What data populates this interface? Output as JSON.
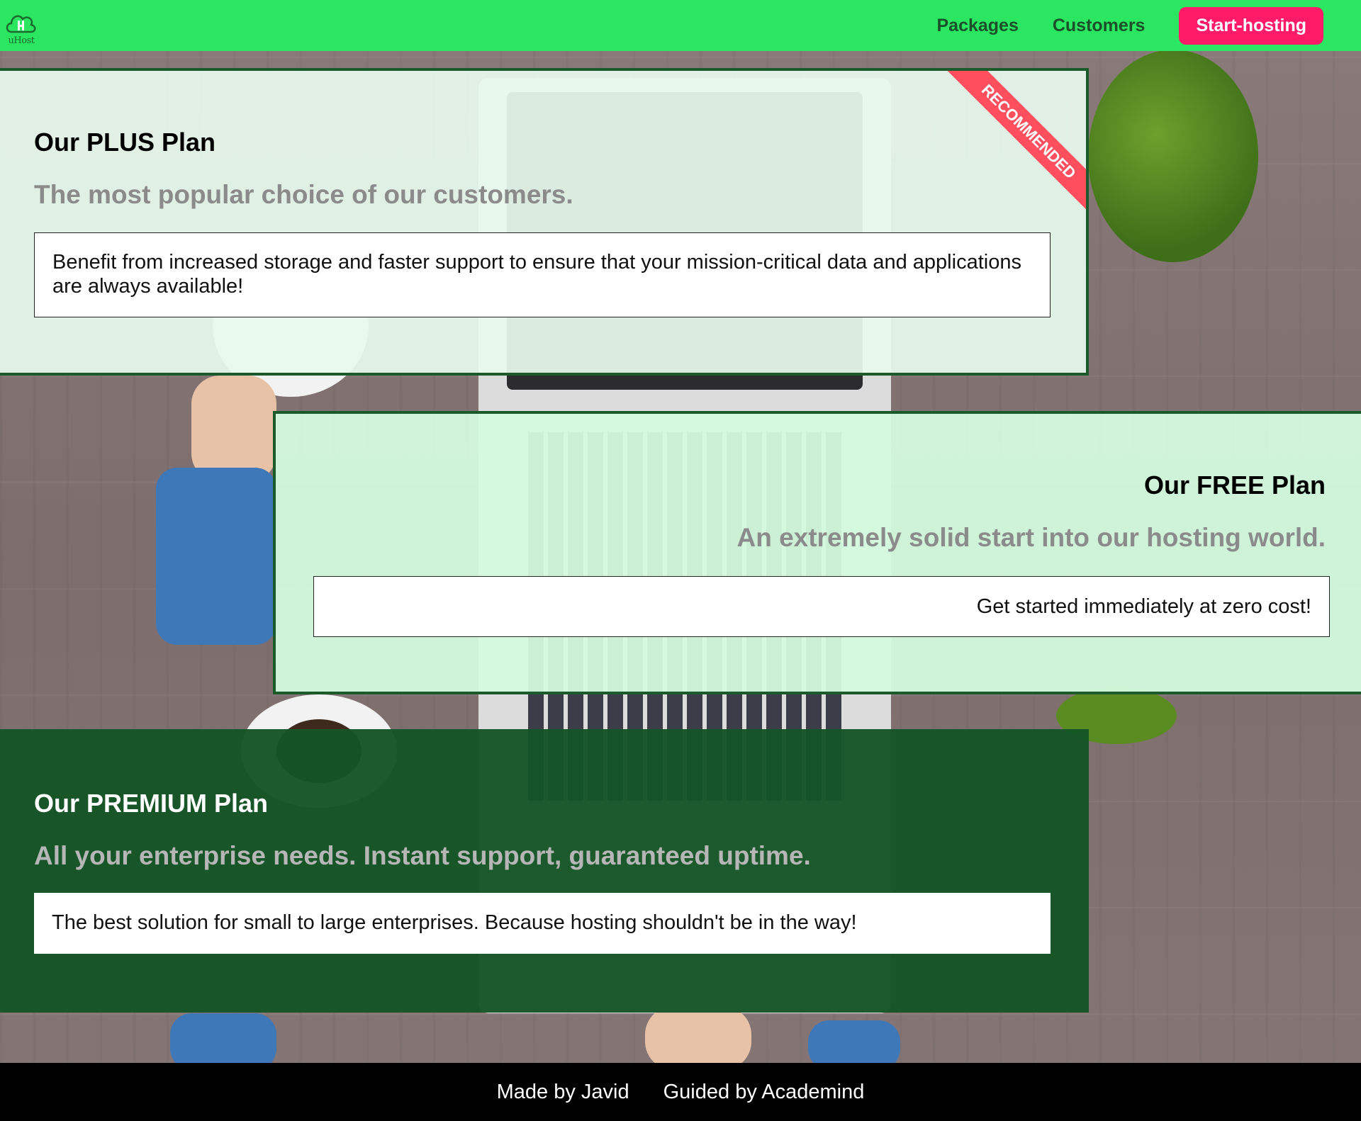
{
  "header": {
    "logo_text": "uHost",
    "nav": {
      "packages": "Packages",
      "customers": "Customers",
      "start_hosting": "Start-hosting"
    }
  },
  "plans": [
    {
      "title": "Our PLUS Plan",
      "subtitle": "The most popular choice of our customers.",
      "description": "Benefit from increased storage and faster support to ensure that your mission-critical data and applications are always available!",
      "badge": "RECOMMENDED"
    },
    {
      "title": "Our FREE Plan",
      "subtitle": "An extremely solid start into our hosting world.",
      "description": "Get started immediately at zero cost!"
    },
    {
      "title": "Our PREMIUM Plan",
      "subtitle": "All your enterprise needs. Instant support, guaranteed uptime.",
      "description": "The best solution for small to large enterprises. Because hosting shouldn't be in the way!"
    }
  ],
  "footer": {
    "made_by": "Made by Javid",
    "guided_by": "Guided by Academind"
  },
  "colors": {
    "header_bg": "#2ae660",
    "cta_bg": "#ff1b68",
    "ribbon_bg": "#ff4f5e",
    "border_dark_green": "#1a5a2b",
    "premium_bg": "#145426",
    "footer_bg": "#000000"
  }
}
